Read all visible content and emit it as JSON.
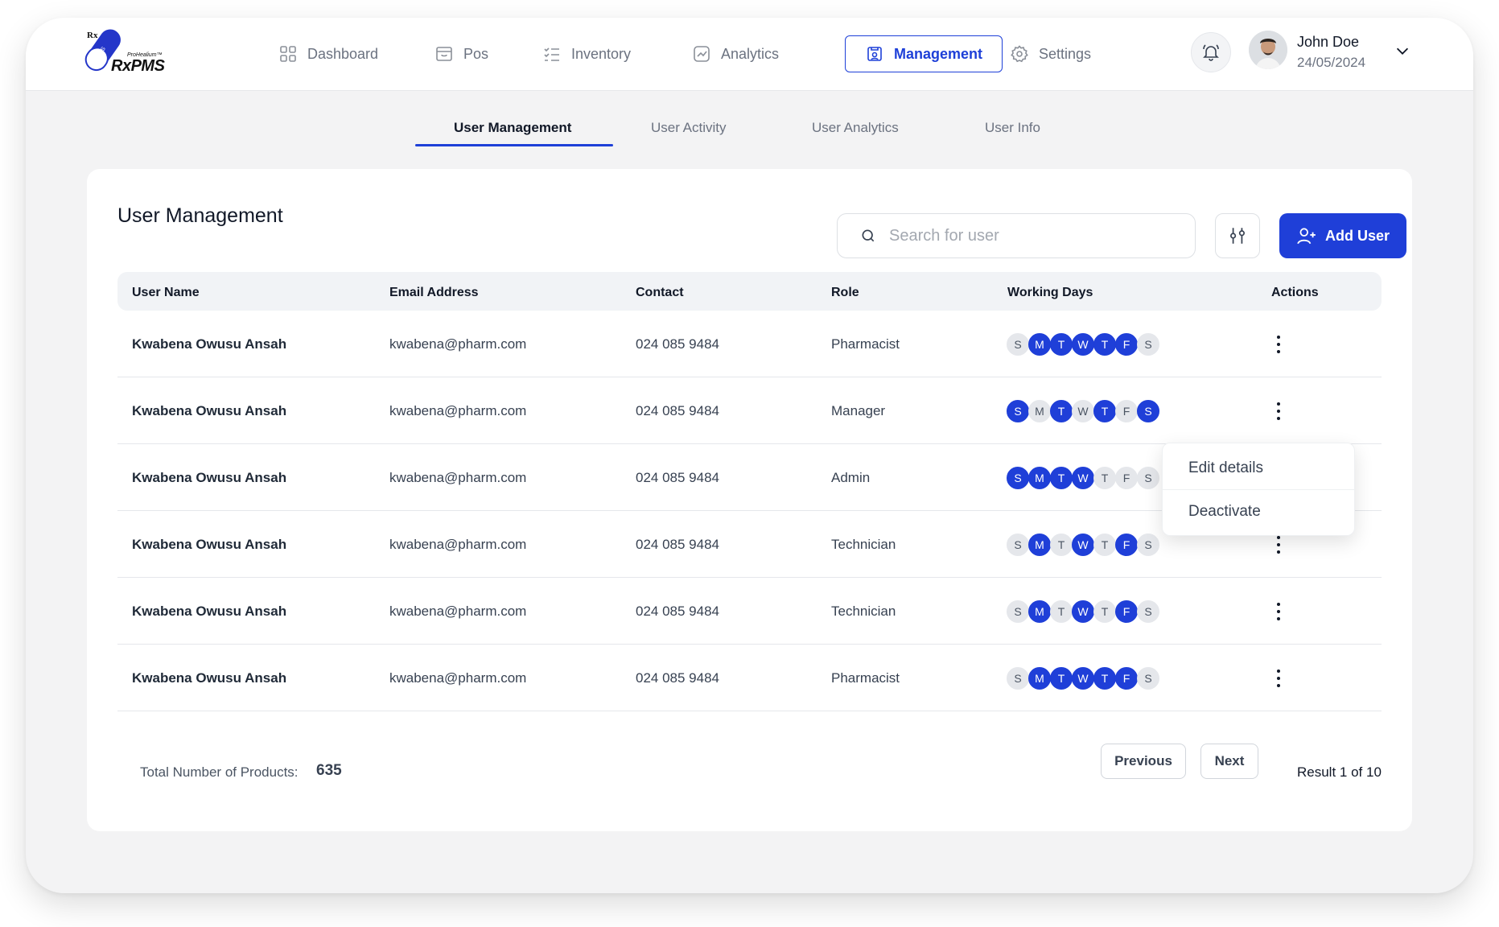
{
  "brand": {
    "name": "RxPMS",
    "tagline": "ProHealium™",
    "rx_mark": "Rx",
    "pill_text": "PMS"
  },
  "nav": [
    {
      "label": "Dashboard",
      "icon": "grid-icon"
    },
    {
      "label": "Pos",
      "icon": "store-icon"
    },
    {
      "label": "Inventory",
      "icon": "checklist-icon"
    },
    {
      "label": "Analytics",
      "icon": "trend-icon"
    },
    {
      "label": "Management",
      "icon": "management-icon",
      "active": true
    },
    {
      "label": "Settings",
      "icon": "gear-icon"
    }
  ],
  "user": {
    "name": "John Doe",
    "date": "24/05/2024"
  },
  "subtabs": [
    "User Management",
    "User Activity",
    "User Analytics",
    "User Info"
  ],
  "page": {
    "title": "User Management",
    "search_placeholder": "Search for user",
    "add_user_label": "Add User"
  },
  "table": {
    "headers": [
      "User Name",
      "Email Address",
      "Contact",
      "Role",
      "Working Days",
      "Actions"
    ],
    "day_letters": [
      "S",
      "M",
      "T",
      "W",
      "T",
      "F",
      "S"
    ],
    "rows": [
      {
        "name": "Kwabena Owusu Ansah",
        "email": "kwabena@pharm.com",
        "contact": "024 085 9484",
        "role": "Pharmacist",
        "days": [
          0,
          1,
          1,
          1,
          1,
          1,
          0
        ]
      },
      {
        "name": "Kwabena Owusu Ansah",
        "email": "kwabena@pharm.com",
        "contact": "024 085 9484",
        "role": "Manager",
        "days": [
          1,
          0,
          1,
          0,
          1,
          0,
          1
        ]
      },
      {
        "name": "Kwabena Owusu Ansah",
        "email": "kwabena@pharm.com",
        "contact": "024 085 9484",
        "role": "Admin",
        "days": [
          1,
          1,
          1,
          1,
          0,
          0,
          0
        ]
      },
      {
        "name": "Kwabena Owusu Ansah",
        "email": "kwabena@pharm.com",
        "contact": "024 085 9484",
        "role": "Technician",
        "days": [
          0,
          1,
          0,
          1,
          0,
          1,
          0
        ]
      },
      {
        "name": "Kwabena Owusu Ansah",
        "email": "kwabena@pharm.com",
        "contact": "024 085 9484",
        "role": "Technician",
        "days": [
          0,
          1,
          0,
          1,
          0,
          1,
          0
        ]
      },
      {
        "name": "Kwabena Owusu Ansah",
        "email": "kwabena@pharm.com",
        "contact": "024 085 9484",
        "role": "Pharmacist",
        "days": [
          0,
          1,
          1,
          1,
          1,
          1,
          0
        ]
      }
    ]
  },
  "dropdown": {
    "items": [
      "Edit details",
      "Deactivate"
    ]
  },
  "footer": {
    "total_label": "Total Number of Products:",
    "total_value": "635",
    "previous_label": "Previous",
    "next_label": "Next",
    "result_text": "Result 1 of 10"
  },
  "colors": {
    "accent": "#1f3fd8",
    "day_off": "#e5e7eb",
    "header_bg": "#f1f3f6"
  }
}
